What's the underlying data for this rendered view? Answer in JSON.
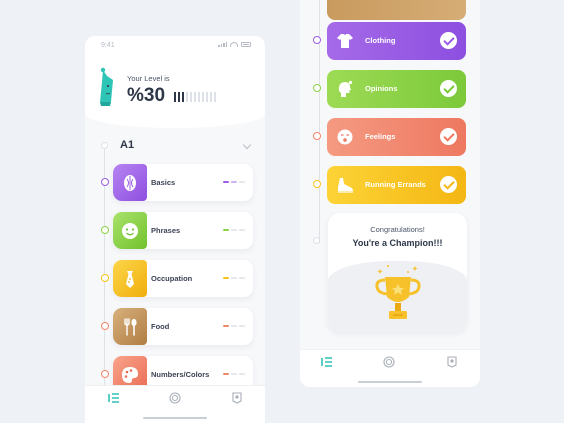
{
  "left_screen": {
    "status_time": "9:41",
    "level_label": "Your Level is",
    "level_value": "%30",
    "level_name": "A1",
    "lessons": [
      {
        "label": "Basics",
        "color": "#9b5de5",
        "icon": "seed-icon"
      },
      {
        "label": "Phrases",
        "color": "#8bd345",
        "icon": "face-icon"
      },
      {
        "label": "Occupation",
        "color": "#f7c31a",
        "icon": "tie-icon"
      },
      {
        "label": "Food",
        "color": "#c89a5e",
        "icon": "fork-spoon-icon"
      },
      {
        "label": "Numbers/Colors",
        "color": "#f2856a",
        "icon": "palette-icon"
      }
    ]
  },
  "right_screen": {
    "lessons": [
      {
        "label": "Clothing",
        "color": "#9b5de5",
        "icon": "shirt-icon"
      },
      {
        "label": "Opinions",
        "color": "#8bd345",
        "icon": "thinking-head-icon"
      },
      {
        "label": "Feelings",
        "color": "#f2856a",
        "icon": "emotion-icon"
      },
      {
        "label": "Running Errands",
        "color": "#f7c31a",
        "icon": "running-shoe-icon"
      }
    ],
    "congrats_text": "Congratulations!",
    "champion_text": "You're a Champion!!!"
  },
  "nav": [
    {
      "icon": "list-icon",
      "active": true
    },
    {
      "icon": "target-icon",
      "active": false
    },
    {
      "icon": "profile-badge-icon",
      "active": false
    }
  ],
  "colors": {
    "accent": "#2ec4b6",
    "ink": "#2d3748"
  }
}
